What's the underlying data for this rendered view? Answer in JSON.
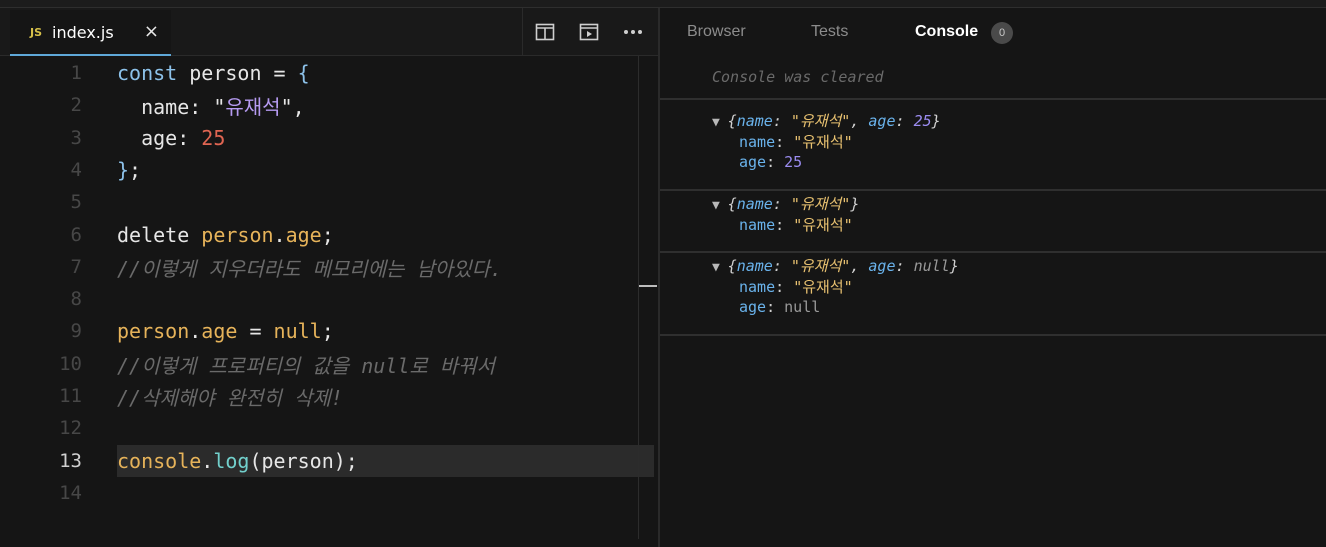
{
  "editor": {
    "tab": {
      "badge": "JS",
      "filename": "index.js",
      "close": "×"
    },
    "actions": [
      "split-layout-icon",
      "preview-icon",
      "more-icon"
    ],
    "lines": [
      {
        "n": "1",
        "parts": [
          [
            "kw",
            "const"
          ],
          [
            "plain",
            " person = "
          ],
          [
            "kw",
            "{"
          ]
        ]
      },
      {
        "n": "2",
        "parts": [
          [
            "plain",
            "  name: "
          ],
          [
            "strq",
            "\""
          ],
          [
            "str",
            "유재석"
          ],
          [
            "strq",
            "\""
          ],
          [
            "plain",
            ","
          ]
        ]
      },
      {
        "n": "3",
        "parts": [
          [
            "plain",
            "  age: "
          ],
          [
            "num-lit",
            "25"
          ]
        ]
      },
      {
        "n": "4",
        "parts": [
          [
            "kw",
            "}"
          ],
          [
            "plain",
            ";"
          ]
        ]
      },
      {
        "n": "5",
        "parts": []
      },
      {
        "n": "6",
        "parts": [
          [
            "plain",
            "delete "
          ],
          [
            "obj",
            "person"
          ],
          [
            "plain",
            "."
          ],
          [
            "prop",
            "age"
          ],
          [
            "plain",
            ";"
          ]
        ]
      },
      {
        "n": "7",
        "parts": [
          [
            "cmt",
            "//이렇게 지우더라도 메모리에는 남아있다."
          ]
        ]
      },
      {
        "n": "8",
        "parts": []
      },
      {
        "n": "9",
        "parts": [
          [
            "obj",
            "person"
          ],
          [
            "plain",
            "."
          ],
          [
            "prop",
            "age"
          ],
          [
            "plain",
            " = "
          ],
          [
            "obj",
            "null"
          ],
          [
            "plain",
            ";"
          ]
        ]
      },
      {
        "n": "10",
        "parts": [
          [
            "cmt",
            "//이렇게 프로퍼티의 값을 null로 바꿔서"
          ]
        ]
      },
      {
        "n": "11",
        "parts": [
          [
            "cmt",
            "//삭제해야 완전히 삭제!"
          ]
        ]
      },
      {
        "n": "12",
        "parts": []
      },
      {
        "n": "13",
        "parts": [
          [
            "obj",
            "console"
          ],
          [
            "plain",
            "."
          ],
          [
            "fn",
            "log"
          ],
          [
            "plain",
            "(person);"
          ]
        ]
      },
      {
        "n": "14",
        "parts": []
      }
    ],
    "active_line": "13"
  },
  "panel": {
    "tabs": [
      {
        "label": "Browser",
        "active": false
      },
      {
        "label": "Tests",
        "active": false
      },
      {
        "label": "Console",
        "active": true
      }
    ],
    "badge_count": "0",
    "cleared_text": "Console was cleared",
    "entries": [
      {
        "summary": [
          [
            "p",
            "{"
          ],
          [
            "k",
            "name"
          ],
          [
            "p",
            ": "
          ],
          [
            "v-str",
            "\"유재석\""
          ],
          [
            "p",
            ", "
          ],
          [
            "k",
            "age"
          ],
          [
            "p",
            ": "
          ],
          [
            "v-num",
            "25"
          ],
          [
            "p",
            "}"
          ]
        ],
        "rows": [
          [
            [
              "k",
              "name"
            ],
            [
              "p",
              ": "
            ],
            [
              "v-str",
              "\"유재석\""
            ]
          ],
          [
            [
              "k",
              "age"
            ],
            [
              "p",
              ": "
            ],
            [
              "v-num",
              "25"
            ]
          ]
        ]
      },
      {
        "summary": [
          [
            "p",
            "{"
          ],
          [
            "k",
            "name"
          ],
          [
            "p",
            ": "
          ],
          [
            "v-str",
            "\"유재석\""
          ],
          [
            "p",
            "}"
          ]
        ],
        "rows": [
          [
            [
              "k",
              "name"
            ],
            [
              "p",
              ": "
            ],
            [
              "v-str",
              "\"유재석\""
            ]
          ]
        ]
      },
      {
        "summary": [
          [
            "p",
            "{"
          ],
          [
            "k",
            "name"
          ],
          [
            "p",
            ": "
          ],
          [
            "v-str",
            "\"유재석\""
          ],
          [
            "p",
            ", "
          ],
          [
            "k",
            "age"
          ],
          [
            "p",
            ": "
          ],
          [
            "v-null",
            "null"
          ],
          [
            "p",
            "}"
          ]
        ],
        "rows": [
          [
            [
              "k",
              "name"
            ],
            [
              "p",
              ": "
            ],
            [
              "v-str",
              "\"유재석\""
            ]
          ],
          [
            [
              "k",
              "age"
            ],
            [
              "p",
              ": "
            ],
            [
              "v-null",
              "null"
            ]
          ]
        ]
      }
    ],
    "triangle": "▼"
  }
}
